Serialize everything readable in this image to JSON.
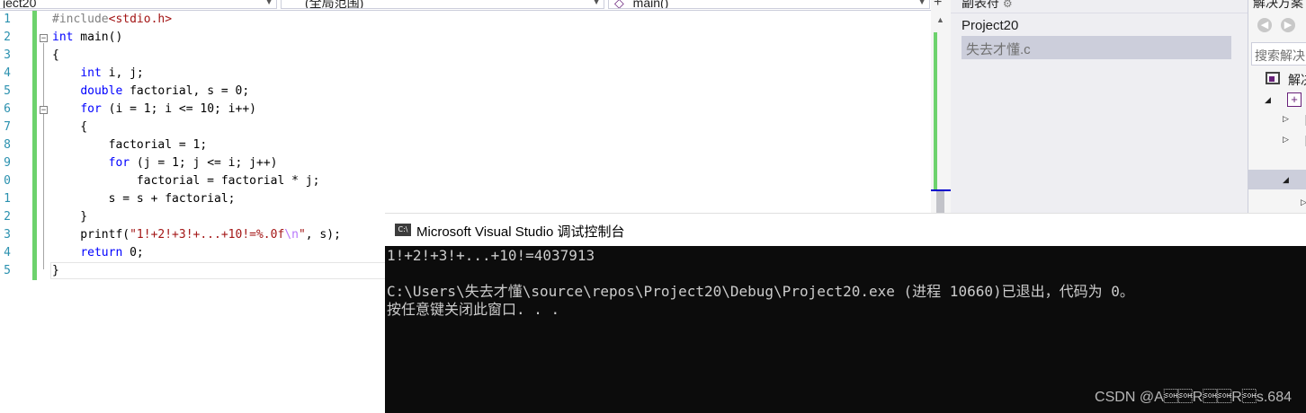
{
  "toolbar": {
    "project_combo": "ject20",
    "scope_combo": "(全局范围)",
    "function_combo": "main()",
    "add_label": "+"
  },
  "editor": {
    "line_numbers": [
      "1",
      "2",
      "3",
      "4",
      "5",
      "6",
      "7",
      "8",
      "9",
      "0",
      "1",
      "2",
      "3",
      "4",
      "5"
    ],
    "lines": [
      "#include<stdio.h>",
      "int main()",
      "{",
      "    int i, j;",
      "    double factorial, s = 0;",
      "    for (i = 1; i <= 10; i++)",
      "    {",
      "        factorial = 1;",
      "        for (j = 1; j <= i; j++)",
      "            factorial = factorial * j;",
      "        s = s + factorial;",
      "    }",
      "    printf(\"1!+2!+3!+...+10!=%.0f\\n\", s);",
      "    return 0;",
      "}"
    ]
  },
  "middle_panel": {
    "header": "副表符",
    "project": "Project20",
    "file": "失去才懂.c"
  },
  "right_panel": {
    "title": "解决方案",
    "search_placeholder": "搜索解决",
    "solution_label": "解决"
  },
  "console": {
    "title": "Microsoft Visual Studio 调试控制台",
    "icon_text": "C:\\",
    "lines": [
      "1!+2!+3!+...+10!=4037913",
      "",
      "C:\\Users\\失去才懂\\source\\repos\\Project20\\Debug\\Project20.exe (进程 10660)已退出，代码为 0。",
      "按任意键关闭此窗口. . ."
    ],
    "watermark": "CSDN @A\u0001\u0001R\u0001\u0001R\u0001s.684"
  },
  "colors": {
    "keyword": "#0000ff",
    "string": "#a31515",
    "preprocessor": "#808080",
    "line_number": "#2b91af",
    "change_bar": "#6dd26d",
    "console_bg": "#0c0c0c"
  }
}
